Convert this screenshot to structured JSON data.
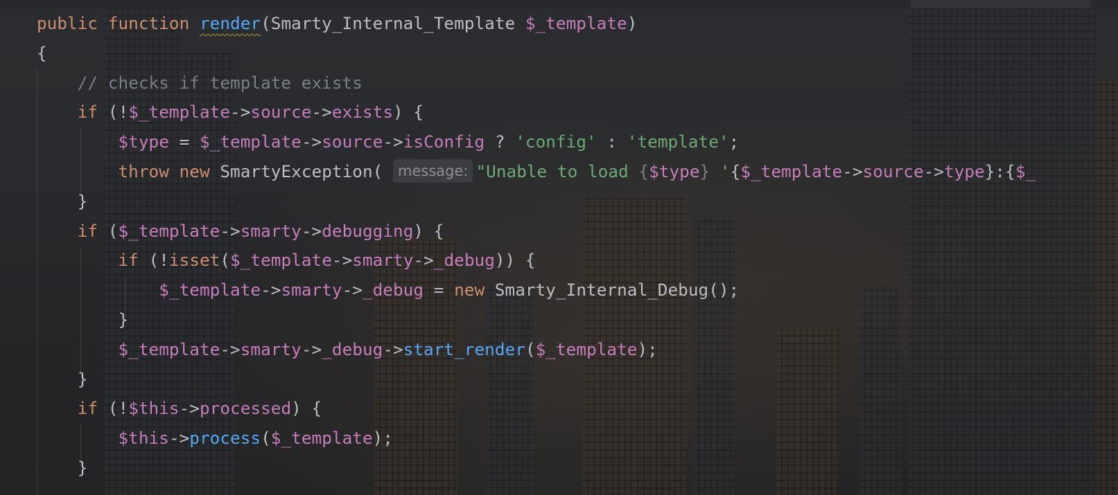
{
  "editor": {
    "lines": [
      {
        "indent": "",
        "tokens": [
          {
            "cls": "kw",
            "text": "public"
          },
          {
            "cls": "plain",
            "text": " "
          },
          {
            "cls": "kw",
            "text": "function"
          },
          {
            "cls": "plain",
            "text": " "
          },
          {
            "cls": "fn-decl",
            "text": "render"
          },
          {
            "cls": "plain",
            "text": "(Smarty_Internal_Template "
          },
          {
            "cls": "var",
            "text": "$_template"
          },
          {
            "cls": "plain",
            "text": ")"
          }
        ]
      },
      {
        "indent": "",
        "tokens": [
          {
            "cls": "plain",
            "text": "{"
          }
        ]
      },
      {
        "indent": "    ",
        "tokens": [
          {
            "cls": "cmt",
            "text": "// checks if template exists"
          }
        ]
      },
      {
        "indent": "    ",
        "tokens": [
          {
            "cls": "kw",
            "text": "if"
          },
          {
            "cls": "plain",
            "text": " (!"
          },
          {
            "cls": "var",
            "text": "$_template"
          },
          {
            "cls": "plain",
            "text": "->"
          },
          {
            "cls": "prop",
            "text": "source"
          },
          {
            "cls": "plain",
            "text": "->"
          },
          {
            "cls": "prop",
            "text": "exists"
          },
          {
            "cls": "plain",
            "text": ") {"
          }
        ]
      },
      {
        "indent": "        ",
        "tokens": [
          {
            "cls": "var",
            "text": "$type"
          },
          {
            "cls": "plain",
            "text": " = "
          },
          {
            "cls": "var",
            "text": "$_template"
          },
          {
            "cls": "plain",
            "text": "->"
          },
          {
            "cls": "prop",
            "text": "source"
          },
          {
            "cls": "plain",
            "text": "->"
          },
          {
            "cls": "prop",
            "text": "isConfig"
          },
          {
            "cls": "plain",
            "text": " ? "
          },
          {
            "cls": "str",
            "text": "'config'"
          },
          {
            "cls": "plain",
            "text": " : "
          },
          {
            "cls": "str",
            "text": "'template'"
          },
          {
            "cls": "plain",
            "text": ";"
          }
        ]
      },
      {
        "indent": "        ",
        "tokens": [
          {
            "cls": "kw",
            "text": "throw"
          },
          {
            "cls": "plain",
            "text": " "
          },
          {
            "cls": "kw",
            "text": "new"
          },
          {
            "cls": "plain",
            "text": " SmartyException( "
          },
          {
            "cls": "hint",
            "text": "message:"
          },
          {
            "cls": "str",
            "text": "\"Unable to load "
          },
          {
            "cls": "cmt",
            "text": "{"
          },
          {
            "cls": "var",
            "text": "$type"
          },
          {
            "cls": "cmt",
            "text": "}"
          },
          {
            "cls": "str",
            "text": " '"
          },
          {
            "cls": "plain",
            "text": "{"
          },
          {
            "cls": "var",
            "text": "$_template"
          },
          {
            "cls": "plain",
            "text": "->"
          },
          {
            "cls": "prop",
            "text": "source"
          },
          {
            "cls": "plain",
            "text": "->"
          },
          {
            "cls": "prop",
            "text": "type"
          },
          {
            "cls": "plain",
            "text": "}:{"
          },
          {
            "cls": "var",
            "text": "$_"
          }
        ]
      },
      {
        "indent": "    ",
        "tokens": [
          {
            "cls": "plain",
            "text": "}"
          }
        ]
      },
      {
        "indent": "    ",
        "tokens": [
          {
            "cls": "kw",
            "text": "if"
          },
          {
            "cls": "plain",
            "text": " ("
          },
          {
            "cls": "var",
            "text": "$_template"
          },
          {
            "cls": "plain",
            "text": "->"
          },
          {
            "cls": "prop",
            "text": "smarty"
          },
          {
            "cls": "plain",
            "text": "->"
          },
          {
            "cls": "prop",
            "text": "debugging"
          },
          {
            "cls": "plain",
            "text": ") {"
          }
        ]
      },
      {
        "indent": "        ",
        "tokens": [
          {
            "cls": "kw",
            "text": "if"
          },
          {
            "cls": "plain",
            "text": " (!"
          },
          {
            "cls": "kw",
            "text": "isset"
          },
          {
            "cls": "plain",
            "text": "("
          },
          {
            "cls": "var",
            "text": "$_template"
          },
          {
            "cls": "plain",
            "text": "->"
          },
          {
            "cls": "prop",
            "text": "smarty"
          },
          {
            "cls": "plain",
            "text": "->"
          },
          {
            "cls": "prop",
            "text": "_debug"
          },
          {
            "cls": "plain",
            "text": ")) {"
          }
        ]
      },
      {
        "indent": "            ",
        "tokens": [
          {
            "cls": "var",
            "text": "$_template"
          },
          {
            "cls": "plain",
            "text": "->"
          },
          {
            "cls": "prop",
            "text": "smarty"
          },
          {
            "cls": "plain",
            "text": "->"
          },
          {
            "cls": "prop",
            "text": "_debug"
          },
          {
            "cls": "plain",
            "text": " = "
          },
          {
            "cls": "kw",
            "text": "new"
          },
          {
            "cls": "plain",
            "text": " Smarty_Internal_Debug();"
          }
        ]
      },
      {
        "indent": "        ",
        "tokens": [
          {
            "cls": "plain",
            "text": "}"
          }
        ]
      },
      {
        "indent": "        ",
        "tokens": [
          {
            "cls": "var",
            "text": "$_template"
          },
          {
            "cls": "plain",
            "text": "->"
          },
          {
            "cls": "prop",
            "text": "smarty"
          },
          {
            "cls": "plain",
            "text": "->"
          },
          {
            "cls": "prop",
            "text": "_debug"
          },
          {
            "cls": "plain",
            "text": "->"
          },
          {
            "cls": "fn-call",
            "text": "start_render"
          },
          {
            "cls": "plain",
            "text": "("
          },
          {
            "cls": "var",
            "text": "$_template"
          },
          {
            "cls": "plain",
            "text": ");"
          }
        ]
      },
      {
        "indent": "    ",
        "tokens": [
          {
            "cls": "plain",
            "text": "}"
          }
        ]
      },
      {
        "indent": "    ",
        "tokens": [
          {
            "cls": "kw",
            "text": "if"
          },
          {
            "cls": "plain",
            "text": " (!"
          },
          {
            "cls": "var",
            "text": "$this"
          },
          {
            "cls": "plain",
            "text": "->"
          },
          {
            "cls": "prop",
            "text": "processed"
          },
          {
            "cls": "plain",
            "text": ") {"
          }
        ]
      },
      {
        "indent": "        ",
        "tokens": [
          {
            "cls": "var",
            "text": "$this"
          },
          {
            "cls": "plain",
            "text": "->"
          },
          {
            "cls": "fn-call",
            "text": "process"
          },
          {
            "cls": "plain",
            "text": "("
          },
          {
            "cls": "var",
            "text": "$_template"
          },
          {
            "cls": "plain",
            "text": ");"
          }
        ]
      },
      {
        "indent": "    ",
        "tokens": [
          {
            "cls": "plain",
            "text": "}"
          }
        ]
      }
    ]
  },
  "colors": {
    "keyword": "#cf8e6d",
    "function": "#56a8f5",
    "variable": "#c77dbb",
    "string": "#6aab73",
    "comment": "#7a7e85",
    "text": "#bcbec4",
    "background": "#2b2c2f"
  }
}
